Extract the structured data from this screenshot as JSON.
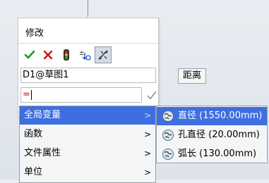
{
  "dialog": {
    "title": "修改",
    "toolbar": {
      "ok_icon": "checkmark-icon",
      "cancel_icon": "x-icon",
      "rebuild_icon": "traffic-light-icon",
      "reset_icon": "spin-increment-icon",
      "mark_icon": "dimension-mark-icon"
    },
    "name_value": "D1@草图1",
    "value_text": "="
  },
  "tooltip": "距离",
  "menu": {
    "items": [
      {
        "label": "全局变量",
        "arrow": ">"
      },
      {
        "label": "函数",
        "arrow": ">"
      },
      {
        "label": "文件属性",
        "arrow": ">"
      },
      {
        "label": "单位",
        "arrow": ">"
      }
    ],
    "selected_index": 0
  },
  "submenu": {
    "items": [
      {
        "label": "直径 (1550.00mm)",
        "icon": "global-variable-icon"
      },
      {
        "label": "孔直径 (20.00mm)",
        "icon": "global-variable-icon"
      },
      {
        "label": "弧长 (130.00mm)",
        "icon": "global-variable-icon"
      }
    ],
    "selected_index": 0
  },
  "colors": {
    "selection": "#3d6fe0",
    "ok_green": "#1a9a1a",
    "cancel_red": "#d01010"
  }
}
